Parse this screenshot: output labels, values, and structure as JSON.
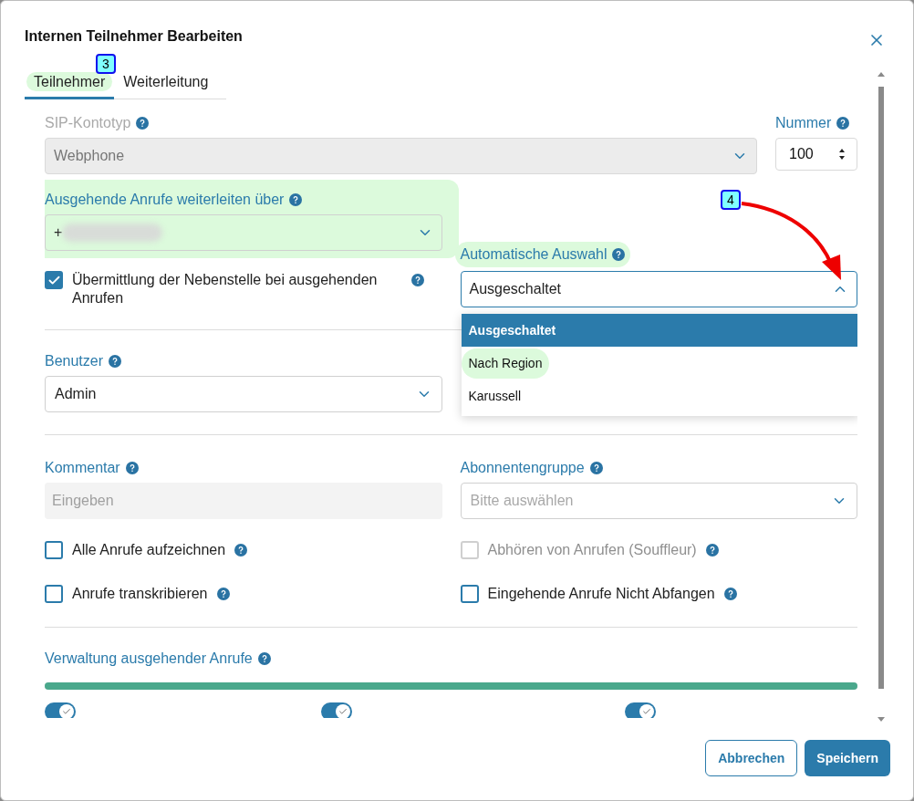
{
  "dialog": {
    "title": "Internen Teilnehmer Bearbeiten"
  },
  "tabs": [
    {
      "label": "Teilnehmer",
      "selected": true,
      "highlighted": true
    },
    {
      "label": "Weiterleitung",
      "selected": false,
      "highlighted": false
    }
  ],
  "annotations": [
    {
      "label": "3"
    },
    {
      "label": "4"
    }
  ],
  "sip_account_type": {
    "label": "SIP-Kontotyp",
    "value": "Webphone",
    "disabled": true
  },
  "number": {
    "label": "Nummer",
    "value": "100"
  },
  "outgoing_route": {
    "label": "Ausgehende Anrufe weiterleiten über",
    "value": "+",
    "highlighted": true
  },
  "transmit_extension": {
    "label": "Übermittlung der Nebenstelle bei ausgehenden Anrufen",
    "checked": true
  },
  "auto_select": {
    "label": "Automatische Auswahl",
    "value": "Ausgeschaltet",
    "expanded": true,
    "highlighted": true,
    "options": [
      {
        "label": "Ausgeschaltet",
        "selected": true,
        "highlighted": false
      },
      {
        "label": "Nach Region",
        "selected": false,
        "highlighted": true
      },
      {
        "label": "Karussell",
        "selected": false,
        "highlighted": false
      }
    ]
  },
  "user": {
    "label": "Benutzer",
    "value": "Admin"
  },
  "comment": {
    "label": "Kommentar",
    "placeholder": "Eingeben",
    "disabled": true
  },
  "subscriber_group": {
    "label": "Abonnentengruppe",
    "placeholder": "Bitte auswählen"
  },
  "checkboxes": [
    {
      "label": "Alle Anrufe aufzeichnen",
      "checked": false,
      "disabled": false
    },
    {
      "label": "Abhören von Anrufen (Souffleur)",
      "checked": false,
      "disabled": true
    },
    {
      "label": "Anrufe transkribieren",
      "checked": false,
      "disabled": false
    },
    {
      "label": "Eingehende Anrufe Nicht Abfangen",
      "checked": false,
      "disabled": false
    }
  ],
  "outgoing_management": {
    "label": "Verwaltung ausgehender Anrufe",
    "level": 1,
    "toggles": [
      {
        "on": true
      },
      {
        "on": true
      },
      {
        "on": true
      }
    ]
  },
  "buttons": [
    {
      "label": "Abbrechen",
      "kind": "secondary"
    },
    {
      "label": "Speichern",
      "kind": "primary"
    }
  ]
}
